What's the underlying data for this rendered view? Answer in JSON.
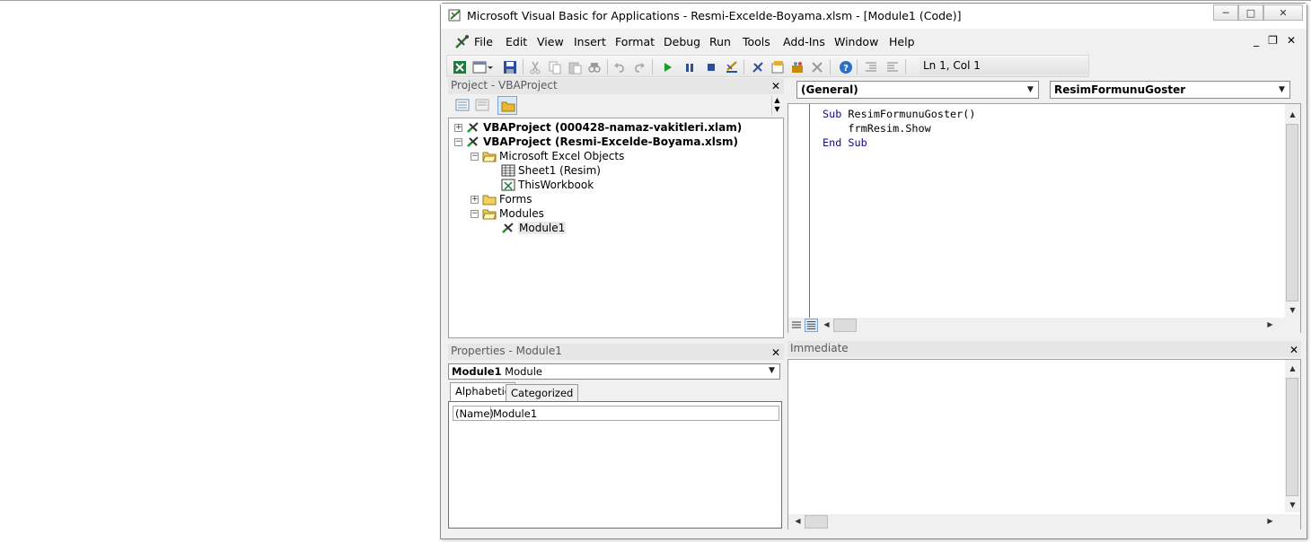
{
  "window": {
    "title": "Microsoft Visual Basic for Applications - Resmi-Excelde-Boyama.xlsm - [Module1 (Code)]",
    "minimize": "─",
    "maximize": "□",
    "close": "✕"
  },
  "menu": {
    "items": [
      "File",
      "Edit",
      "View",
      "Insert",
      "Format",
      "Debug",
      "Run",
      "Tools",
      "Add-Ins",
      "Window",
      "Help"
    ],
    "mdi_minimize": "_",
    "mdi_restore": "❐",
    "mdi_close": "✕"
  },
  "toolbar": {
    "position": "Ln 1, Col 1"
  },
  "project": {
    "title": "Project - VBAProject",
    "close": "✕",
    "tree": [
      {
        "label": "VBAProject (000428-namaz-vakitleri.xlam)",
        "expander": "+"
      },
      {
        "label": "VBAProject (Resmi-Excelde-Boyama.xlsm)",
        "expander": "−"
      },
      {
        "label": "Microsoft Excel Objects",
        "expander": "−"
      },
      {
        "label": "Sheet1 (Resim)"
      },
      {
        "label": "ThisWorkbook"
      },
      {
        "label": "Forms",
        "expander": "+"
      },
      {
        "label": "Modules",
        "expander": "−"
      },
      {
        "label": "Module1"
      }
    ]
  },
  "code": {
    "object_combo": "(General)",
    "proc_combo": "ResimFormunuGoster",
    "lines": [
      {
        "kw": "Sub",
        "rest": " ResimFormunuGoster()"
      },
      {
        "kw": "",
        "rest": "    frmResim.Show"
      },
      {
        "kw": "End Sub",
        "rest": ""
      }
    ]
  },
  "properties": {
    "title": "Properties - Module1",
    "close": "✕",
    "object_name": "Module1",
    "object_type": "Module",
    "tabs": [
      "Alphabetic",
      "Categorized"
    ],
    "rows": [
      {
        "key": "(Name)",
        "value": "Module1"
      }
    ]
  },
  "immediate": {
    "title": "Immediate",
    "close": "✕"
  },
  "colors": {
    "keyword": "#0a0a8a",
    "panel_title_bg": "#e6e6e6",
    "window_bg": "#f0f0f0"
  }
}
